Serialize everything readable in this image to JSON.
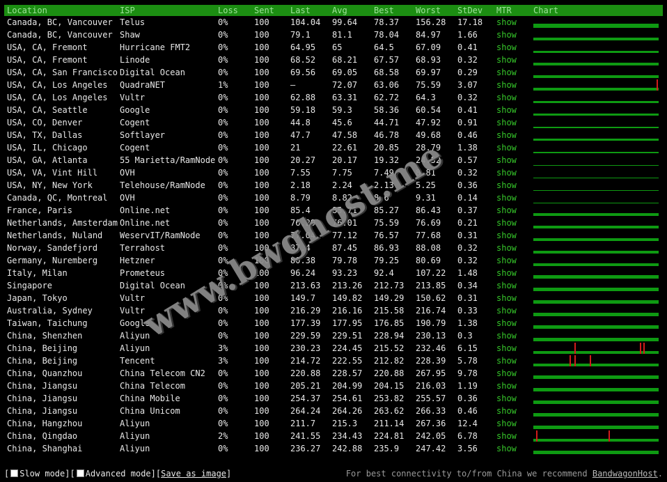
{
  "columns": [
    "Location",
    "ISP",
    "Loss",
    "Sent",
    "Last",
    "Avg",
    "Best",
    "Worst",
    "StDev",
    "MTR",
    "Chart"
  ],
  "mtr_label": "show",
  "colors": {
    "header_bg": "#1c8e12",
    "header_text": "#9ee49a",
    "link": "#36c82a",
    "bar": "#0e9a12",
    "spike": "#d41b1b"
  },
  "rows": [
    {
      "location": "Canada, BC, Vancouver",
      "isp": "Telus",
      "loss": "0%",
      "sent": "100",
      "last": "104.04",
      "avg": "99.64",
      "best": "78.37",
      "worst": "156.28",
      "stdev": "17.18",
      "chart": {
        "level": 0.75,
        "spikes": []
      }
    },
    {
      "location": "Canada, BC, Vancouver",
      "isp": "Shaw",
      "loss": "0%",
      "sent": "100",
      "last": "79.1",
      "avg": "81.1",
      "best": "78.04",
      "worst": "84.97",
      "stdev": "1.66",
      "chart": {
        "level": 0.55,
        "spikes": []
      }
    },
    {
      "location": "USA, CA, Fremont",
      "isp": "Hurricane FMT2",
      "loss": "0%",
      "sent": "100",
      "last": "64.95",
      "avg": "65",
      "best": "64.5",
      "worst": "67.09",
      "stdev": "0.41",
      "chart": {
        "level": 0.4,
        "spikes": []
      }
    },
    {
      "location": "USA, CA, Fremont",
      "isp": "Linode",
      "loss": "0%",
      "sent": "100",
      "last": "68.52",
      "avg": "68.21",
      "best": "67.57",
      "worst": "68.93",
      "stdev": "0.32",
      "chart": {
        "level": 0.45,
        "spikes": []
      }
    },
    {
      "location": "USA, CA, San Francisco",
      "isp": "Digital Ocean",
      "loss": "0%",
      "sent": "100",
      "last": "69.56",
      "avg": "69.05",
      "best": "68.58",
      "worst": "69.97",
      "stdev": "0.29",
      "chart": {
        "level": 0.45,
        "spikes": []
      }
    },
    {
      "location": "USA, CA, Los Angeles",
      "isp": "QuadraNET",
      "loss": "1%",
      "sent": "100",
      "last": "–",
      "avg": "72.07",
      "best": "63.06",
      "worst": "75.59",
      "stdev": "3.07",
      "chart": {
        "level": 0.5,
        "spikes": [
          0.985
        ]
      }
    },
    {
      "location": "USA, CA, Los Angeles",
      "isp": "Vultr",
      "loss": "0%",
      "sent": "100",
      "last": "62.88",
      "avg": "63.31",
      "best": "62.72",
      "worst": "64.3",
      "stdev": "0.32",
      "chart": {
        "level": 0.4,
        "spikes": []
      }
    },
    {
      "location": "USA, CA, Seattle",
      "isp": "Google",
      "loss": "0%",
      "sent": "100",
      "last": "59.18",
      "avg": "59.3",
      "best": "58.36",
      "worst": "60.54",
      "stdev": "0.41",
      "chart": {
        "level": 0.4,
        "spikes": []
      }
    },
    {
      "location": "USA, CO, Denver",
      "isp": "Cogent",
      "loss": "0%",
      "sent": "100",
      "last": "44.8",
      "avg": "45.6",
      "best": "44.71",
      "worst": "47.92",
      "stdev": "0.91",
      "chart": {
        "level": 0.3,
        "spikes": []
      }
    },
    {
      "location": "USA, TX, Dallas",
      "isp": "Softlayer",
      "loss": "0%",
      "sent": "100",
      "last": "47.7",
      "avg": "47.58",
      "best": "46.78",
      "worst": "49.68",
      "stdev": "0.46",
      "chart": {
        "level": 0.32,
        "spikes": []
      }
    },
    {
      "location": "USA, IL, Chicago",
      "isp": "Cogent",
      "loss": "0%",
      "sent": "100",
      "last": "21",
      "avg": "22.61",
      "best": "20.85",
      "worst": "28.79",
      "stdev": "1.38",
      "chart": {
        "level": 0.2,
        "spikes": []
      }
    },
    {
      "location": "USA, GA, Atlanta",
      "isp": "55 Marietta/RamNode",
      "loss": "0%",
      "sent": "100",
      "last": "20.27",
      "avg": "20.17",
      "best": "19.32",
      "worst": "24.52",
      "stdev": "0.57",
      "chart": {
        "level": 0.15,
        "spikes": []
      }
    },
    {
      "location": "USA, VA, Vint Hill",
      "isp": "OVH",
      "loss": "0%",
      "sent": "100",
      "last": "7.55",
      "avg": "7.75",
      "best": "7.49",
      "worst": "8.81",
      "stdev": "0.32",
      "chart": {
        "level": 0.06,
        "spikes": []
      }
    },
    {
      "location": "USA, NY, New York",
      "isp": "Telehouse/RamNode",
      "loss": "0%",
      "sent": "100",
      "last": "2.18",
      "avg": "2.24",
      "best": "2.13",
      "worst": "5.25",
      "stdev": "0.36",
      "chart": {
        "level": 0.04,
        "spikes": []
      }
    },
    {
      "location": "Canada, QC, Montreal",
      "isp": "OVH",
      "loss": "0%",
      "sent": "100",
      "last": "8.79",
      "avg": "8.82",
      "best": "8.6",
      "worst": "9.31",
      "stdev": "0.14",
      "chart": {
        "level": 0.06,
        "spikes": []
      }
    },
    {
      "location": "France, Paris",
      "isp": "Online.net",
      "loss": "0%",
      "sent": "100",
      "last": "85.4",
      "avg": "85.71",
      "best": "85.27",
      "worst": "86.43",
      "stdev": "0.37",
      "chart": {
        "level": 0.55,
        "spikes": []
      }
    },
    {
      "location": "Netherlands, Amsterdam",
      "isp": "Online.net",
      "loss": "0%",
      "sent": "100",
      "last": "76.29",
      "avg": "76.01",
      "best": "75.59",
      "worst": "76.69",
      "stdev": "0.21",
      "chart": {
        "level": 0.5,
        "spikes": []
      }
    },
    {
      "location": "Netherlands, Nuland",
      "isp": "WeservIT/RamNode",
      "loss": "0%",
      "sent": "100",
      "last": "77.04",
      "avg": "77.12",
      "best": "76.57",
      "worst": "77.68",
      "stdev": "0.31",
      "chart": {
        "level": 0.5,
        "spikes": []
      }
    },
    {
      "location": "Norway, Sandefjord",
      "isp": "Terrahost",
      "loss": "0%",
      "sent": "100",
      "last": "87.4",
      "avg": "87.45",
      "best": "86.93",
      "worst": "88.08",
      "stdev": "0.32",
      "chart": {
        "level": 0.55,
        "spikes": []
      }
    },
    {
      "location": "Germany, Nuremberg",
      "isp": "Hetzner",
      "loss": "0%",
      "sent": "100",
      "last": "80.38",
      "avg": "79.78",
      "best": "79.25",
      "worst": "80.69",
      "stdev": "0.32",
      "chart": {
        "level": 0.52,
        "spikes": []
      }
    },
    {
      "location": "Italy, Milan",
      "isp": "Prometeus",
      "loss": "0%",
      "sent": "100",
      "last": "96.24",
      "avg": "93.23",
      "best": "92.4",
      "worst": "107.22",
      "stdev": "1.48",
      "chart": {
        "level": 0.6,
        "spikes": []
      }
    },
    {
      "location": "Singapore",
      "isp": "Digital Ocean",
      "loss": "0%",
      "sent": "100",
      "last": "213.63",
      "avg": "213.26",
      "best": "212.73",
      "worst": "213.85",
      "stdev": "0.34",
      "chart": {
        "level": 0.65,
        "spikes": []
      }
    },
    {
      "location": "Japan, Tokyo",
      "isp": "Vultr",
      "loss": "0%",
      "sent": "100",
      "last": "149.7",
      "avg": "149.82",
      "best": "149.29",
      "worst": "150.62",
      "stdev": "0.31",
      "chart": {
        "level": 0.6,
        "spikes": []
      }
    },
    {
      "location": "Australia, Sydney",
      "isp": "Vultr",
      "loss": "0%",
      "sent": "100",
      "last": "216.29",
      "avg": "216.16",
      "best": "215.58",
      "worst": "216.74",
      "stdev": "0.33",
      "chart": {
        "level": 0.65,
        "spikes": []
      }
    },
    {
      "location": "Taiwan, Taichung",
      "isp": "Google",
      "loss": "0%",
      "sent": "100",
      "last": "177.39",
      "avg": "177.95",
      "best": "176.85",
      "worst": "190.79",
      "stdev": "1.38",
      "chart": {
        "level": 0.62,
        "spikes": []
      }
    },
    {
      "location": "China, Shenzhen",
      "isp": "Aliyun",
      "loss": "0%",
      "sent": "100",
      "last": "229.59",
      "avg": "229.51",
      "best": "228.94",
      "worst": "230.13",
      "stdev": "0.3",
      "chart": {
        "level": 0.65,
        "spikes": []
      }
    },
    {
      "location": "China, Beijing",
      "isp": "Aliyun",
      "loss": "3%",
      "sent": "100",
      "last": "230.23",
      "avg": "224.45",
      "best": "215.52",
      "worst": "232.46",
      "stdev": "6.15",
      "chart": {
        "level": 0.55,
        "spikes": [
          0.33,
          0.85,
          0.88
        ]
      }
    },
    {
      "location": "China, Beijing",
      "isp": "Tencent",
      "loss": "3%",
      "sent": "100",
      "last": "214.72",
      "avg": "222.55",
      "best": "212.82",
      "worst": "228.39",
      "stdev": "5.78",
      "chart": {
        "level": 0.55,
        "spikes": [
          0.29,
          0.33,
          0.45
        ]
      }
    },
    {
      "location": "China, Quanzhou",
      "isp": "China Telecom CN2",
      "loss": "0%",
      "sent": "100",
      "last": "220.88",
      "avg": "228.57",
      "best": "220.88",
      "worst": "267.95",
      "stdev": "9.78",
      "chart": {
        "level": 0.6,
        "spikes": []
      }
    },
    {
      "location": "China, Jiangsu",
      "isp": "China Telecom",
      "loss": "0%",
      "sent": "100",
      "last": "205.21",
      "avg": "204.99",
      "best": "204.15",
      "worst": "216.03",
      "stdev": "1.19",
      "chart": {
        "level": 0.6,
        "spikes": []
      }
    },
    {
      "location": "China, Jiangsu",
      "isp": "China Mobile",
      "loss": "0%",
      "sent": "100",
      "last": "254.37",
      "avg": "254.61",
      "best": "253.82",
      "worst": "255.57",
      "stdev": "0.36",
      "chart": {
        "level": 0.65,
        "spikes": []
      }
    },
    {
      "location": "China, Jiangsu",
      "isp": "China Unicom",
      "loss": "0%",
      "sent": "100",
      "last": "264.24",
      "avg": "264.26",
      "best": "263.62",
      "worst": "266.33",
      "stdev": "0.46",
      "chart": {
        "level": 0.65,
        "spikes": []
      }
    },
    {
      "location": "China, Hangzhou",
      "isp": "Aliyun",
      "loss": "0%",
      "sent": "100",
      "last": "211.7",
      "avg": "215.3",
      "best": "211.14",
      "worst": "267.36",
      "stdev": "12.4",
      "chart": {
        "level": 0.6,
        "spikes": []
      }
    },
    {
      "location": "China, Qingdao",
      "isp": "Aliyun",
      "loss": "2%",
      "sent": "100",
      "last": "241.55",
      "avg": "234.43",
      "best": "224.81",
      "worst": "242.05",
      "stdev": "6.78",
      "chart": {
        "level": 0.55,
        "spikes": [
          0.02,
          0.6
        ]
      }
    },
    {
      "location": "China, Shanghai",
      "isp": "Aliyun",
      "loss": "0%",
      "sent": "100",
      "last": "236.27",
      "avg": "242.88",
      "best": "235.9",
      "worst": "247.42",
      "stdev": "3.56",
      "chart": {
        "level": 0.6,
        "spikes": []
      }
    }
  ],
  "footer": {
    "open_bracket": "[",
    "slow_mode": "Slow mode",
    "sep": "][",
    "advanced_mode": "Advanced mode",
    "save_image": "Save as image",
    "close_bracket": "]",
    "recommend_text": "For best connectivity to/from China we recommend ",
    "recommend_link": "BandwagonHost",
    "recommend_end": "."
  },
  "watermark": "www.bwghost.me"
}
